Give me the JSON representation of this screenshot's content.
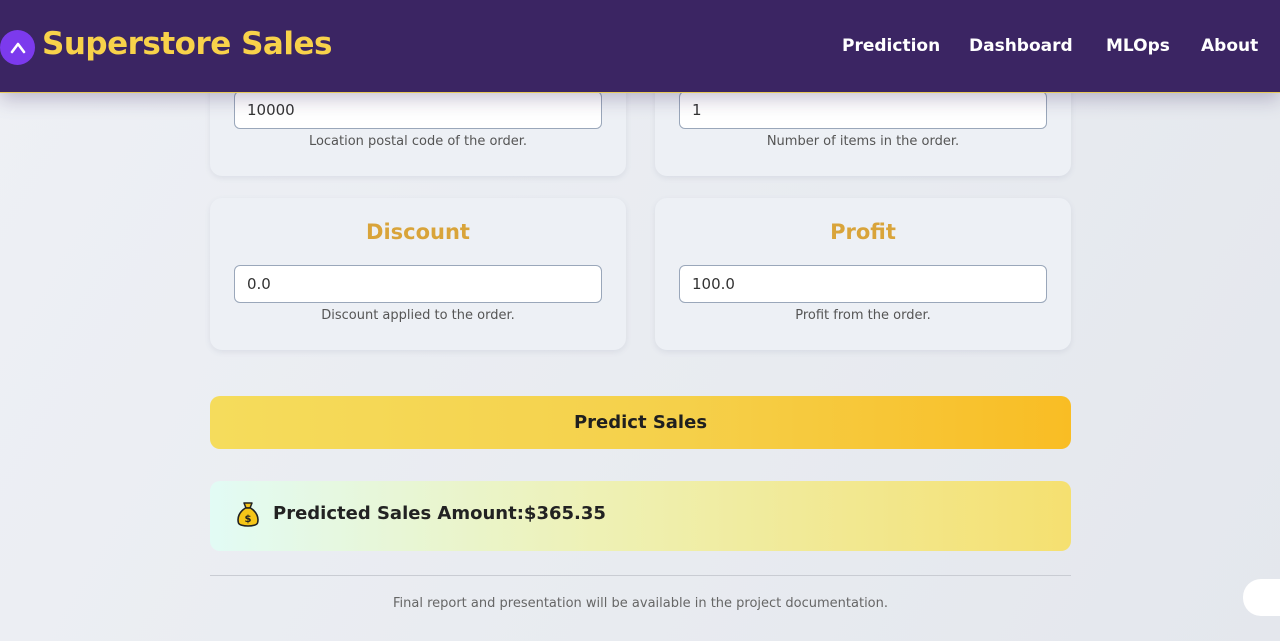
{
  "header": {
    "title": "Superstore Sales",
    "logo_icon": "chevron-up-icon",
    "nav": [
      "Prediction",
      "Dashboard",
      "MLOps",
      "About"
    ]
  },
  "fields": [
    {
      "title": "",
      "value": "10000",
      "help": "Location postal code of the order."
    },
    {
      "title": "",
      "value": "1",
      "help": "Number of items in the order."
    },
    {
      "title": "Discount",
      "value": "0.0",
      "help": "Discount applied to the order."
    },
    {
      "title": "Profit",
      "value": "100.0",
      "help": "Profit from the order."
    }
  ],
  "predict_button": "Predict Sales",
  "result": {
    "icon": "money-bag-icon",
    "text": "Predicted Sales Amount:$365.35"
  },
  "footer_note": "Final report and presentation will be available in the project documentation.",
  "colors": {
    "navbar": "#3b2563",
    "brand": "#f8d24a",
    "accent": "#d9a43a",
    "button": "#f9bd24"
  }
}
